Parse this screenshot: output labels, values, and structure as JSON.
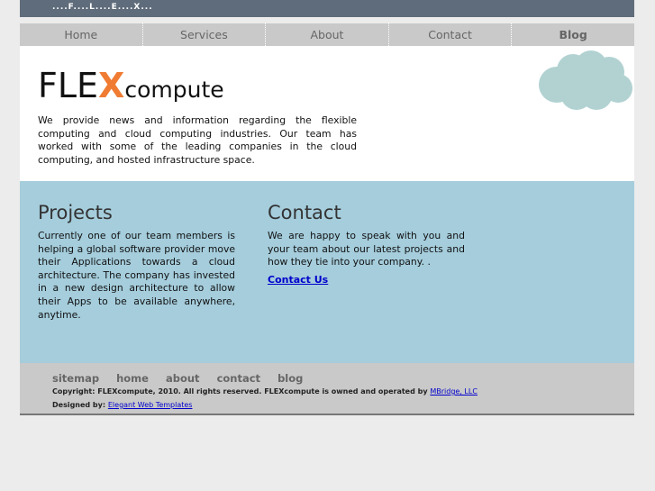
{
  "topbar": {
    "text": "....F....L....E....X..."
  },
  "nav": [
    "Home",
    "Services",
    "About",
    "Contact",
    "Blog"
  ],
  "logo": {
    "flex": "FLE",
    "x": "X",
    "compute": "compute"
  },
  "intro": "We provide news and information regarding the flexible computing and cloud computing industries. Our team has worked with some of the leading companies in the cloud computing, and hosted infrastructure space.",
  "projects": {
    "title": "Projects",
    "text": "Currently one of our team members is helping a global software provider move their Applications towards a cloud architecture. The company has invested in a new design architecture to allow their Apps to be available anywhere, anytime."
  },
  "contact": {
    "title": "Contact",
    "text": "We are happy to speak with you and your team about our latest projects and how they tie into your company. .",
    "link": "Contact Us"
  },
  "footer": {
    "links": [
      "sitemap",
      "home",
      "about",
      "contact",
      "blog"
    ],
    "copyright": "Copyright: FLEXcompute, 2010. All rights reserved. FLEXcompute is owned and operated by",
    "owner_link": "MBridge, LLC",
    "designed_label": "Designed by:",
    "designer_link": "Elegant Web Templates"
  },
  "colors": {
    "accent": "#f07b32",
    "band": "#a5cddc",
    "topbar": "#5f6c7b",
    "nav": "#c9c9c9",
    "link": "#0000cc"
  }
}
